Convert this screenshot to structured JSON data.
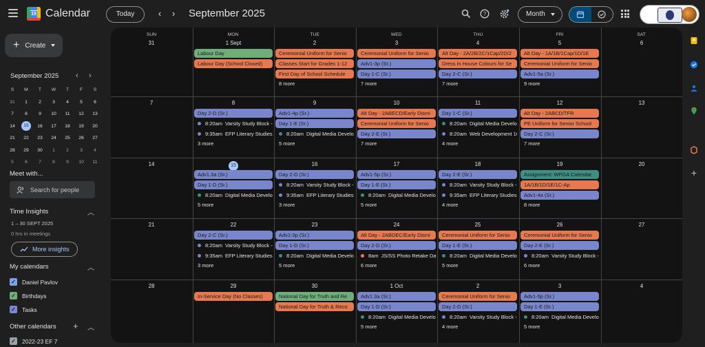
{
  "header": {
    "app_title": "Calendar",
    "logo_number": "15",
    "today_label": "Today",
    "month_title": "September 2025",
    "view_label": "Month"
  },
  "sidebar": {
    "create_label": "Create",
    "mini_calendar": {
      "title": "September 2025",
      "weekday_headers": [
        "S",
        "M",
        "T",
        "W",
        "T",
        "F",
        "S"
      ],
      "weeks": [
        [
          "31",
          "1",
          "2",
          "3",
          "4",
          "5",
          "6"
        ],
        [
          "7",
          "8",
          "9",
          "10",
          "11",
          "12",
          "13"
        ],
        [
          "14",
          "15",
          "16",
          "17",
          "18",
          "19",
          "20"
        ],
        [
          "21",
          "22",
          "23",
          "24",
          "25",
          "26",
          "27"
        ],
        [
          "28",
          "29",
          "30",
          "1",
          "2",
          "3",
          "4"
        ],
        [
          "5",
          "6",
          "7",
          "8",
          "9",
          "10",
          "11"
        ]
      ],
      "today": "15"
    },
    "meet_with_heading": "Meet with...",
    "search_people_placeholder": "Search for people",
    "time_insights_heading": "Time Insights",
    "insight_range": "1 – 30 SEPT 2025",
    "insight_hours": "0 hrs in meetings",
    "more_insights_label": "More insights",
    "my_calendars_heading": "My calendars",
    "my_calendars": [
      {
        "name": "Daniel Pavlov",
        "color": "#7ba4e8"
      },
      {
        "name": "Birthdays",
        "color": "#6fae7b"
      },
      {
        "name": "Tasks",
        "color": "#7b86d6"
      }
    ],
    "other_calendars_heading": "Other calendars",
    "other_calendars": [
      {
        "name": "2022-23 EF 7",
        "color": "#9aa0a6"
      }
    ]
  },
  "colors": {
    "blue": "#7986cb",
    "orange": "#e6794f",
    "green": "#6fae7b",
    "teal": "#3e8e84",
    "accent": "#a8c7fa"
  },
  "calendar": {
    "weekdays": [
      "SUN",
      "MON",
      "TUE",
      "WED",
      "THU",
      "FRI",
      "SAT"
    ],
    "weeks": [
      {
        "days": [
          {
            "num": "31",
            "events": []
          },
          {
            "num": "1 Sept",
            "events": [
              {
                "type": "chip",
                "color": "green",
                "text": "Labour Day"
              },
              {
                "type": "chip",
                "color": "orange",
                "text": "Labour Day (School Closed)"
              }
            ]
          },
          {
            "num": "2",
            "events": [
              {
                "type": "chip",
                "color": "orange",
                "text": "Ceremonial Uniform for Senio"
              },
              {
                "type": "chip",
                "color": "orange",
                "text": "Classes Start for Grades 1-12"
              },
              {
                "type": "chip",
                "color": "orange",
                "text": "First Day of School Schedule"
              }
            ],
            "more": "8 more"
          },
          {
            "num": "3",
            "events": [
              {
                "type": "chip",
                "color": "orange",
                "text": "Ceremonial Uniform for Senio"
              },
              {
                "type": "chip",
                "color": "blue",
                "text": "Adv1-3p (Sr.)"
              },
              {
                "type": "chip",
                "color": "blue",
                "text": "Day 1-C (Sr.)"
              }
            ],
            "more": "7 more"
          },
          {
            "num": "4",
            "events": [
              {
                "type": "chip",
                "color": "orange",
                "text": "Alt Day - 2A/2B/2C/1Cap/2D/2"
              },
              {
                "type": "chip",
                "color": "orange",
                "text": "Dress in House Colours for Se"
              },
              {
                "type": "chip",
                "color": "blue",
                "text": "Day 2-C (Sr.)"
              }
            ],
            "more": "7 more"
          },
          {
            "num": "5",
            "events": [
              {
                "type": "chip",
                "color": "orange",
                "text": "Alt Day - 1A/1B/1Cap/1D/1E"
              },
              {
                "type": "chip",
                "color": "orange",
                "text": "Ceremonial Uniform for Senio"
              },
              {
                "type": "chip",
                "color": "blue",
                "text": "Adv1-5a (Sr.)"
              }
            ],
            "more": "9 more"
          },
          {
            "num": "6",
            "events": []
          }
        ]
      },
      {
        "days": [
          {
            "num": "7",
            "events": []
          },
          {
            "num": "8",
            "events": [
              {
                "type": "chip",
                "color": "blue",
                "text": "Day 2-D (Sr.)"
              },
              {
                "type": "timed",
                "color": "blue",
                "time": "8:20am",
                "text": "Varsity Study Block -"
              },
              {
                "type": "timed",
                "color": "blue",
                "time": "9:35am",
                "text": "EFP Literary Studies"
              }
            ],
            "more": "3 more"
          },
          {
            "num": "9",
            "events": [
              {
                "type": "chip",
                "color": "blue",
                "text": "Adv1-4p (Sr.)"
              },
              {
                "type": "chip",
                "color": "blue",
                "text": "Day 1-E (Sr.)"
              },
              {
                "type": "timed",
                "color": "teal",
                "time": "8:20am",
                "text": "Digital Media Develo"
              }
            ],
            "more": "5 more"
          },
          {
            "num": "10",
            "events": [
              {
                "type": "chip",
                "color": "orange",
                "text": "Alt Day - 2ABECD/Early Dismi"
              },
              {
                "type": "chip",
                "color": "orange",
                "text": "Ceremonial Uniform for Senio"
              },
              {
                "type": "chip",
                "color": "blue",
                "text": "Day 2-E (Sr.)"
              }
            ],
            "more": "7 more"
          },
          {
            "num": "11",
            "events": [
              {
                "type": "chip",
                "color": "blue",
                "text": "Day 1-C (Sr.)"
              },
              {
                "type": "timed",
                "color": "teal",
                "time": "8:20am",
                "text": "Digital Media Develo"
              },
              {
                "type": "timed",
                "color": "blue",
                "time": "8:20am",
                "text": "Web Development 10"
              }
            ],
            "more": "4 more"
          },
          {
            "num": "12",
            "events": [
              {
                "type": "chip",
                "color": "orange",
                "text": "Alt Day - 2ABCD/TFR"
              },
              {
                "type": "chip",
                "color": "orange",
                "text": "PE Uniform for Senior School"
              },
              {
                "type": "chip",
                "color": "blue",
                "text": "Day 2-C (Sr.)"
              }
            ],
            "more": "7 more"
          },
          {
            "num": "13",
            "events": []
          }
        ]
      },
      {
        "days": [
          {
            "num": "14",
            "events": []
          },
          {
            "num": "15",
            "today": true,
            "events": [
              {
                "type": "chip",
                "color": "blue",
                "text": "Adv1.3a (Sr.)"
              },
              {
                "type": "chip",
                "color": "blue",
                "text": "Day 1-D (Sr.)"
              },
              {
                "type": "timed",
                "color": "teal",
                "time": "8:20am",
                "text": "Digital Media Develo"
              }
            ],
            "more": "5 more"
          },
          {
            "num": "16",
            "events": [
              {
                "type": "chip",
                "color": "blue",
                "text": "Day 2-D (Sr.)"
              },
              {
                "type": "timed",
                "color": "blue",
                "time": "8:20am",
                "text": "Varsity Study Block -"
              },
              {
                "type": "timed",
                "color": "blue",
                "time": "9:35am",
                "text": "EFP Literary Studies"
              }
            ],
            "more": "3 more"
          },
          {
            "num": "17",
            "events": [
              {
                "type": "chip",
                "color": "blue",
                "text": "Adv1-5p (Sr.)"
              },
              {
                "type": "chip",
                "color": "blue",
                "text": "Day 1-E (Sr.)"
              },
              {
                "type": "timed",
                "color": "teal",
                "time": "8:20am",
                "text": "Digital Media Develo"
              }
            ],
            "more": "5 more"
          },
          {
            "num": "18",
            "events": [
              {
                "type": "chip",
                "color": "blue",
                "text": "Day 2-E (Sr.)"
              },
              {
                "type": "timed",
                "color": "blue",
                "time": "8:20am",
                "text": "Varsity Study Block -"
              },
              {
                "type": "timed",
                "color": "blue",
                "time": "9:35am",
                "text": "EFP Literary Studies"
              }
            ],
            "more": "4 more"
          },
          {
            "num": "19",
            "events": [
              {
                "type": "chip",
                "color": "teal",
                "text": "Assignment: WPGA Calendar"
              },
              {
                "type": "chip",
                "color": "orange",
                "text": "1A/1B/1D/1E/1C-Ap"
              },
              {
                "type": "chip",
                "color": "blue",
                "text": "Adv1-4a (Sr.)"
              }
            ],
            "more": "8 more"
          },
          {
            "num": "20",
            "events": []
          }
        ]
      },
      {
        "days": [
          {
            "num": "21",
            "events": []
          },
          {
            "num": "22",
            "events": [
              {
                "type": "chip",
                "color": "blue",
                "text": "Day 2-C (Sr.)"
              },
              {
                "type": "timed",
                "color": "blue",
                "time": "8:20am",
                "text": "Varsity Study Block -"
              },
              {
                "type": "timed",
                "color": "blue",
                "time": "9:35am",
                "text": "EFP Literary Studies"
              }
            ],
            "more": "3 more"
          },
          {
            "num": "23",
            "events": [
              {
                "type": "chip",
                "color": "blue",
                "text": "Adv1-3p (Sr.)"
              },
              {
                "type": "chip",
                "color": "blue",
                "text": "Day 1-D (Sr.)"
              },
              {
                "type": "timed",
                "color": "teal",
                "time": "8:20am",
                "text": "Digital Media Develo"
              }
            ],
            "more": "5 more"
          },
          {
            "num": "24",
            "events": [
              {
                "type": "chip",
                "color": "orange",
                "text": "Alt Day - 2ABDEC/Early Dismi"
              },
              {
                "type": "chip",
                "color": "blue",
                "text": "Day 2-D (Sr.)"
              },
              {
                "type": "timed",
                "color": "orange",
                "time": "8am",
                "text": "JS/SS Photo Retake Day"
              }
            ],
            "more": "6 more"
          },
          {
            "num": "25",
            "events": [
              {
                "type": "chip",
                "color": "orange",
                "text": "Ceremonial Uniform for Senio"
              },
              {
                "type": "chip",
                "color": "blue",
                "text": "Day 1-E (Sr.)"
              },
              {
                "type": "timed",
                "color": "teal",
                "time": "8:20am",
                "text": "Digital Media Develo"
              }
            ],
            "more": "5 more"
          },
          {
            "num": "26",
            "events": [
              {
                "type": "chip",
                "color": "orange",
                "text": "Ceremonial Uniform for Senio"
              },
              {
                "type": "chip",
                "color": "blue",
                "text": "Day 2-E (Sr.)"
              },
              {
                "type": "timed",
                "color": "blue",
                "time": "8:20am",
                "text": "Varsity Study Block -"
              }
            ],
            "more": "6 more"
          },
          {
            "num": "27",
            "events": []
          }
        ]
      },
      {
        "days": [
          {
            "num": "28",
            "events": []
          },
          {
            "num": "29",
            "events": [
              {
                "type": "chip",
                "color": "orange",
                "text": "In-Service Day (No Classes)"
              }
            ]
          },
          {
            "num": "30",
            "events": [
              {
                "type": "chip",
                "color": "green",
                "text": "National Day for Truth and Re"
              },
              {
                "type": "chip",
                "color": "orange",
                "text": "National Day for Truth & Reco"
              }
            ]
          },
          {
            "num": "1 Oct",
            "events": [
              {
                "type": "chip",
                "color": "blue",
                "text": "Adv1.3a (Sr.)"
              },
              {
                "type": "chip",
                "color": "blue",
                "text": "Day 1-D (Sr.)"
              },
              {
                "type": "timed",
                "color": "teal",
                "time": "8:20am",
                "text": "Digital Media Develo"
              }
            ],
            "more": "5 more"
          },
          {
            "num": "2",
            "events": [
              {
                "type": "chip",
                "color": "orange",
                "text": "Ceremonial Uniform for Senio"
              },
              {
                "type": "chip",
                "color": "blue",
                "text": "Day 2-D (Sr.)"
              },
              {
                "type": "timed",
                "color": "blue",
                "time": "8:20am",
                "text": "Varsity Study Block -"
              }
            ],
            "more": "4 more"
          },
          {
            "num": "3",
            "events": [
              {
                "type": "chip",
                "color": "blue",
                "text": "Adv1-5p (Sr.)"
              },
              {
                "type": "chip",
                "color": "blue",
                "text": "Day 1-E (Sr.)"
              },
              {
                "type": "timed",
                "color": "teal",
                "time": "8:20am",
                "text": "Digital Media Develo"
              }
            ],
            "more": "5 more"
          },
          {
            "num": "4",
            "events": []
          }
        ]
      }
    ]
  }
}
